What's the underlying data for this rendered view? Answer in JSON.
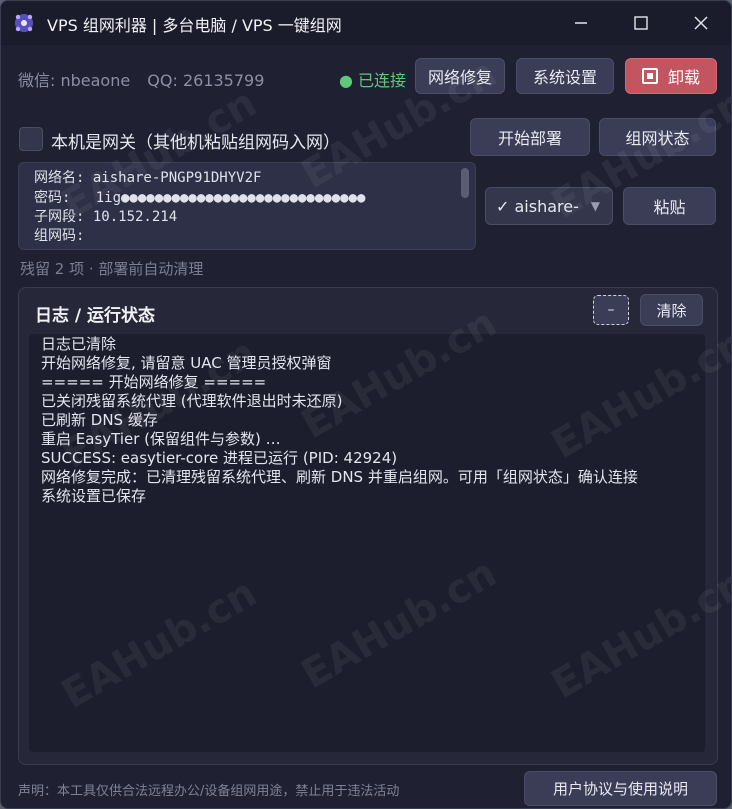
{
  "window": {
    "title": "VPS 组网利器 | 多台电脑 / VPS 一键组网"
  },
  "header": {
    "wechat": "微信: nbeaone",
    "qq": "QQ: 26135799",
    "status": "● 已连接",
    "repair_label": "网络修复",
    "settings_label": "系统设置",
    "uninstall_label": "卸载"
  },
  "gateway": {
    "checkbox_label": "本机是网关（其他机粘贴组网码入网）",
    "deploy_label": "开始部署",
    "netstatus_label": "组网状态"
  },
  "info": {
    "lines": [
      "网络名: aishare-PNGP91DHYV2F",
      "密码:   1ig●●●●●●●●●●●●●●●●●●●●●●●●●●●●●",
      "子网段: 10.152.214",
      "组网码:"
    ]
  },
  "network_select": {
    "value": "✓ aishare-"
  },
  "paste_label": "粘贴",
  "residue_text": "残留 2 项 · 部署前自动清理",
  "log": {
    "title": "日志 / 运行状态",
    "collapse_label": "–",
    "clear_label": "清除",
    "lines": [
      "日志已清除",
      "开始网络修复, 请留意 UAC 管理员授权弹窗",
      "===== 开始网络修复 =====",
      "已关闭残留系统代理 (代理软件退出时未还原)",
      "已刷新 DNS 缓存",
      "重启 EasyTier (保留组件与参数) …",
      "SUCCESS: easytier-core 进程已运行 (PID: 42924)",
      "网络修复完成：已清理残留系统代理、刷新 DNS 并重启组网。可用「组网状态」确认连接",
      "系统设置已保存"
    ]
  },
  "footer": {
    "note": "声明：本工具仅供合法远程办公/设备组网用途，禁止用于违法活动",
    "agreement_label": "用户协议与使用说明"
  },
  "watermark": "EAHub.cn",
  "colors": {
    "background": "#1f2133",
    "button": "#3a3d55",
    "danger": "#c2555f",
    "connected": "#5ec97a"
  }
}
